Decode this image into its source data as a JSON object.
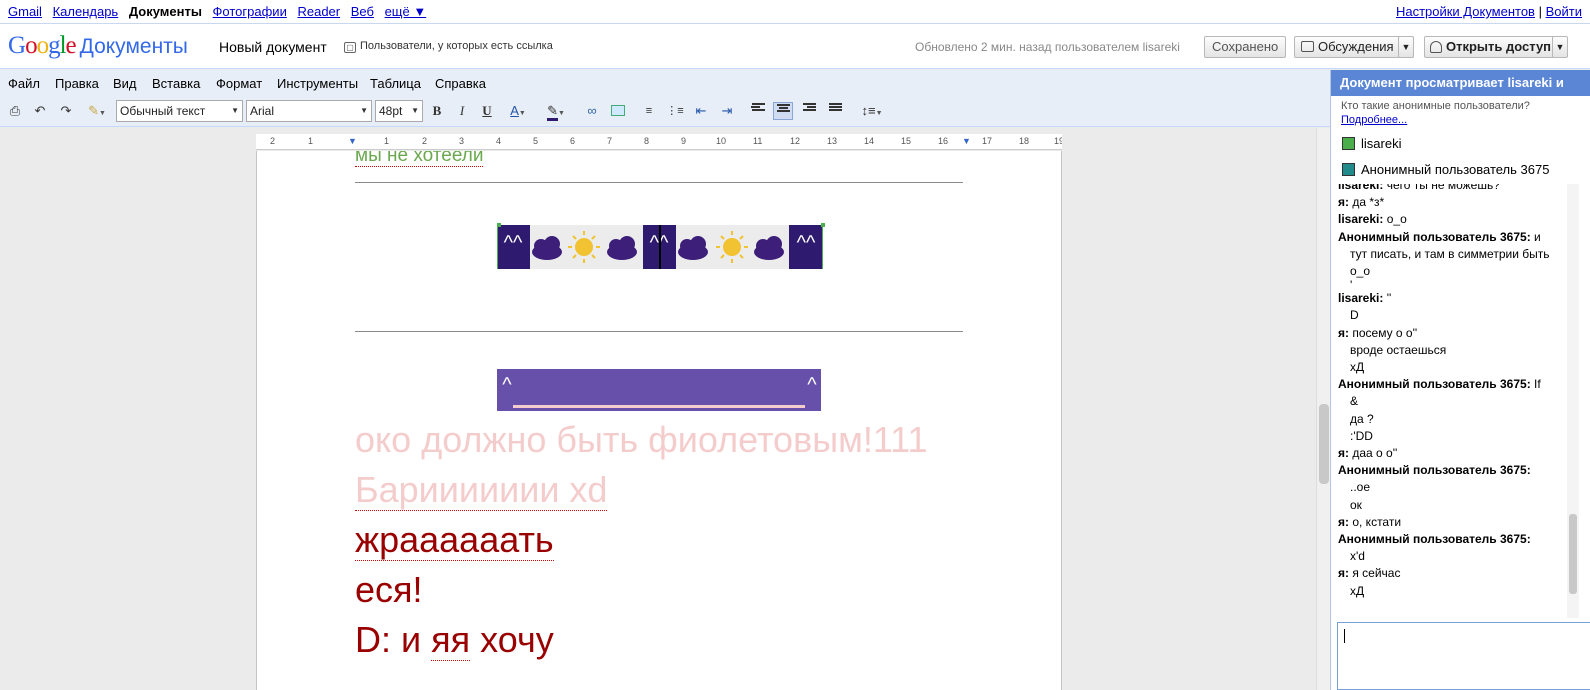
{
  "topnav": {
    "links": [
      "Gmail",
      "Календарь",
      "Документы",
      "Фотографии",
      "Reader",
      "Веб",
      "ещё ▼"
    ],
    "current_index": 2,
    "right_settings": "Настройки Документов",
    "right_sep": "|",
    "right_login": "Войти"
  },
  "header": {
    "logo_letters": [
      "G",
      "o",
      "o",
      "g",
      "l",
      "e"
    ],
    "product": "Документы",
    "doc_title": "Новый документ",
    "share_note": "Пользователи, у которых есть ссылка",
    "updated": "Обновлено 2 мин. назад пользователем lisareki",
    "saved_btn": "Сохранено",
    "discuss_btn": "Обсуждения",
    "share_btn": "Открыть доступ"
  },
  "menu": [
    "Файл",
    "Правка",
    "Вид",
    "Вставка",
    "Формат",
    "Инструменты",
    "Таблица",
    "Справка"
  ],
  "toolbar": {
    "style_value": "Обычный текст",
    "font_value": "Arial",
    "size_value": "48pt",
    "bold": "B",
    "italic": "I",
    "underline": "U",
    "text_color": "A"
  },
  "ruler": {
    "ticks": [
      "2",
      "1",
      "1",
      "2",
      "3",
      "4",
      "5",
      "6",
      "7",
      "8",
      "9",
      "10",
      "11",
      "12",
      "13",
      "14",
      "15",
      "16",
      "17",
      "18",
      "19"
    ]
  },
  "document": {
    "line0": "мы не хотеели",
    "line1": "око должно быть фиолетовым!111",
    "line2": "Бариииииии xd",
    "line3": "жраааааать",
    "line4": "еся!",
    "line5_a": "D: и ",
    "line5_b": "яя",
    "line5_c": " хочу",
    "banner1_caret": "^^",
    "banner2_left": "^",
    "banner2_right": "^",
    "colors": {
      "banner_dark": "#2e1a6e",
      "banner_light": "#6650a9",
      "cloud": "#3d1f7a",
      "sun": "#f1c232"
    }
  },
  "panel": {
    "header": "Документ просматривает lisareki и",
    "who_question": "Кто такие анонимные пользователи?",
    "more": "Подробнее...",
    "viewers": [
      {
        "name": "lisareki",
        "color": "#4aae4a"
      },
      {
        "name": "Анонимный пользователь 3675",
        "color": "#218b8c"
      }
    ],
    "messages": [
      {
        "name": "lisareki:",
        "lines": [
          "чего ты не можешь?"
        ]
      },
      {
        "name": "я:",
        "lines": [
          "да *з*"
        ]
      },
      {
        "name": "lisareki:",
        "lines": [
          "о_о"
        ]
      },
      {
        "name": "Анонимный пользователь 3675:",
        "lines": [
          "и",
          "тут писать, и там в симметрии быть",
          "о_о",
          "'"
        ]
      },
      {
        "name": "lisareki:",
        "lines": [
          "''",
          "D"
        ]
      },
      {
        "name": "я:",
        "lines": [
          "посему о о''",
          "вроде остаешься",
          "хД"
        ]
      },
      {
        "name": "Анонимный пользователь 3675:",
        "lines": [
          "If",
          "&",
          "да ?",
          ":'DD"
        ]
      },
      {
        "name": "я:",
        "lines": [
          "даа о о''"
        ]
      },
      {
        "name": "Анонимный пользователь 3675:",
        "lines": [
          "",
          "..ое",
          "ок"
        ]
      },
      {
        "name": "я:",
        "lines": [
          "о, кстати"
        ]
      },
      {
        "name": "Анонимный пользователь 3675:",
        "lines": [
          "",
          "x'd"
        ]
      },
      {
        "name": "я:",
        "lines": [
          "я сейчас",
          "хД"
        ]
      }
    ]
  }
}
